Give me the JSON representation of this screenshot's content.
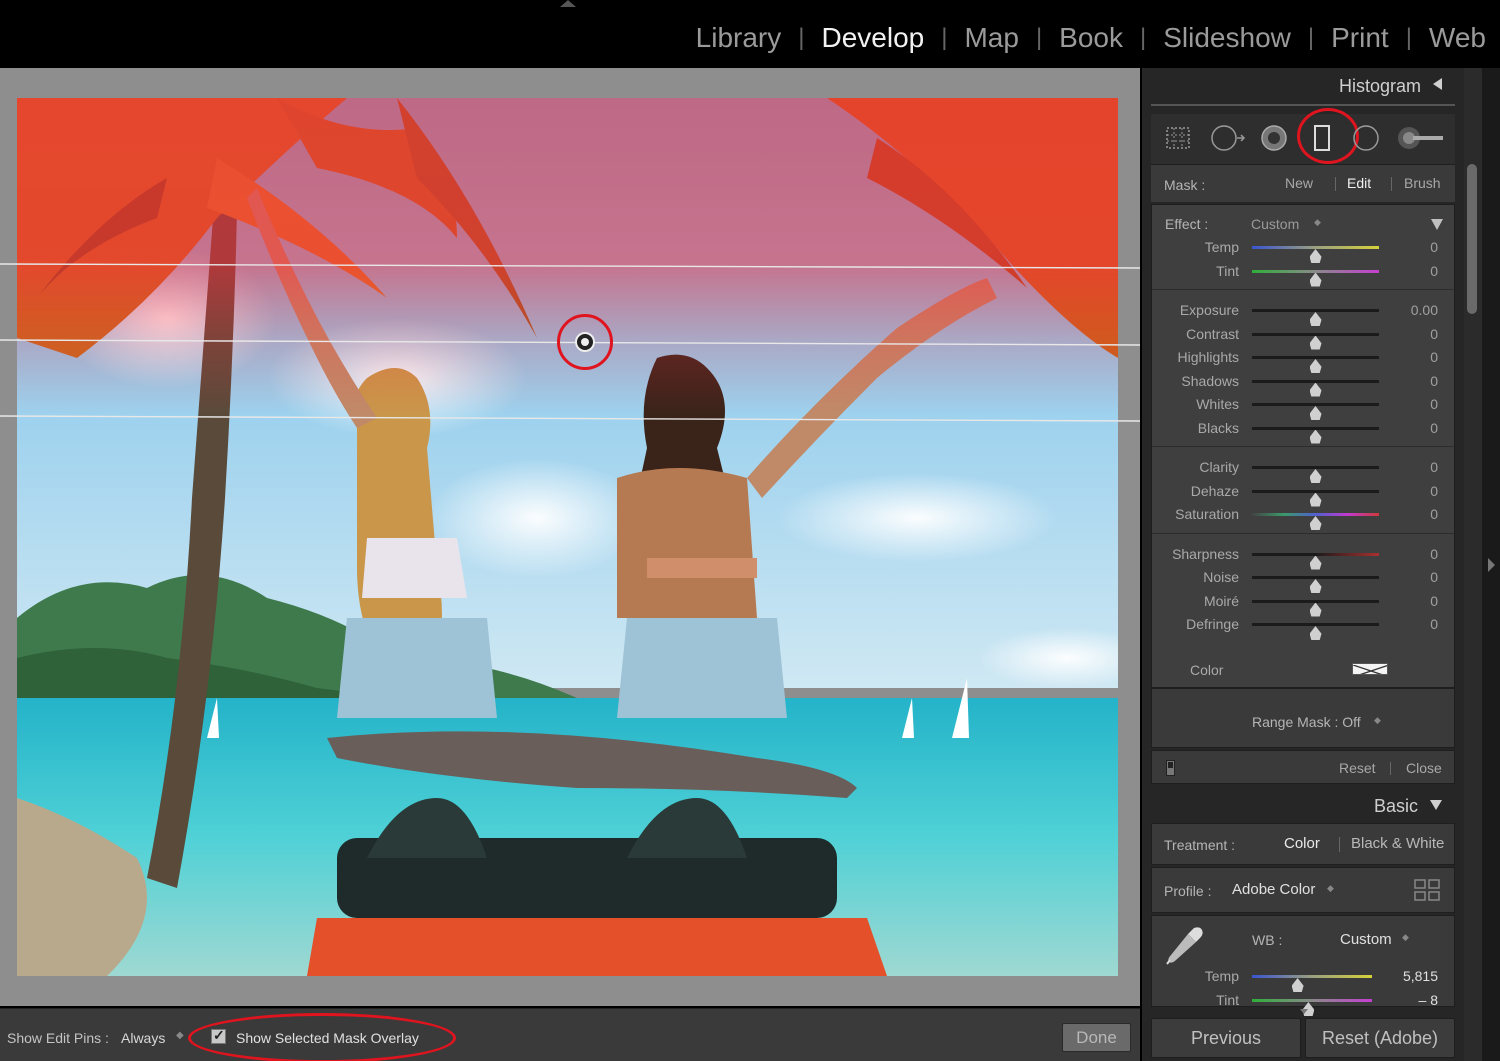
{
  "modules": {
    "items": [
      {
        "label": "Library",
        "active": false
      },
      {
        "label": "Develop",
        "active": true
      },
      {
        "label": "Map",
        "active": false
      },
      {
        "label": "Book",
        "active": false
      },
      {
        "label": "Slideshow",
        "active": false
      },
      {
        "label": "Print",
        "active": false
      },
      {
        "label": "Web",
        "active": false
      }
    ],
    "separator": "|"
  },
  "histogram": {
    "title": "Histogram"
  },
  "tools": {
    "items": [
      "crop-overlay",
      "spot-removal",
      "red-eye-correction",
      "graduated-filter",
      "radial-filter",
      "adjustment-brush"
    ],
    "selected": "graduated-filter"
  },
  "mask": {
    "label": "Mask :",
    "new": "New",
    "edit": "Edit",
    "brush": "Brush",
    "selected": "Edit"
  },
  "effect": {
    "label": "Effect :",
    "value": "Custom",
    "arrows": "◆",
    "groups": [
      [
        {
          "label": "Temp",
          "value": "0",
          "position": 0.5,
          "track": "temp"
        },
        {
          "label": "Tint",
          "value": "0",
          "position": 0.5,
          "track": "tint"
        }
      ],
      [
        {
          "label": "Exposure",
          "value": "0.00",
          "position": 0.5,
          "track": "plain"
        },
        {
          "label": "Contrast",
          "value": "0",
          "position": 0.5,
          "track": "plain"
        },
        {
          "label": "Highlights",
          "value": "0",
          "position": 0.5,
          "track": "plain"
        },
        {
          "label": "Shadows",
          "value": "0",
          "position": 0.5,
          "track": "plain"
        },
        {
          "label": "Whites",
          "value": "0",
          "position": 0.5,
          "track": "plain"
        },
        {
          "label": "Blacks",
          "value": "0",
          "position": 0.5,
          "track": "plain"
        }
      ],
      [
        {
          "label": "Clarity",
          "value": "0",
          "position": 0.5,
          "track": "plain"
        },
        {
          "label": "Dehaze",
          "value": "0",
          "position": 0.5,
          "track": "plain"
        },
        {
          "label": "Saturation",
          "value": "0",
          "position": 0.5,
          "track": "saturation"
        }
      ],
      [
        {
          "label": "Sharpness",
          "value": "0",
          "position": 0.5,
          "track": "sharp"
        },
        {
          "label": "Noise",
          "value": "0",
          "position": 0.5,
          "track": "plain"
        },
        {
          "label": "Moiré",
          "value": "0",
          "position": 0.5,
          "track": "plain"
        },
        {
          "label": "Defringe",
          "value": "0",
          "position": 0.5,
          "track": "plain"
        }
      ]
    ],
    "color_label": "Color"
  },
  "range_mask": {
    "label": "Range Mask : Off",
    "arrows": "◆"
  },
  "panel_actions": {
    "reset": "Reset",
    "close": "Close"
  },
  "basic": {
    "title": "Basic",
    "treatment_label": "Treatment :",
    "treatment_color": "Color",
    "treatment_bw": "Black & White",
    "treatment_selected": "Color",
    "profile_label": "Profile :",
    "profile_value": "Adobe Color",
    "wb_label": "WB :",
    "wb_value": "Custom",
    "temp": {
      "label": "Temp",
      "value": "5,815",
      "position": 0.38
    },
    "tint": {
      "label": "Tint",
      "value": "– 8",
      "position": 0.47
    }
  },
  "buttons": {
    "previous": "Previous",
    "reset_adobe": "Reset (Adobe)",
    "done": "Done"
  },
  "bottombar": {
    "pins_label": "Show Edit Pins :",
    "pins_value": "Always",
    "overlay_label": "Show Selected Mask Overlay",
    "overlay_checked": true
  },
  "colors": {
    "highlight_ring": "#e0141e",
    "mask_overlay": "#ff2a3c",
    "panel_bg": "#262626"
  }
}
